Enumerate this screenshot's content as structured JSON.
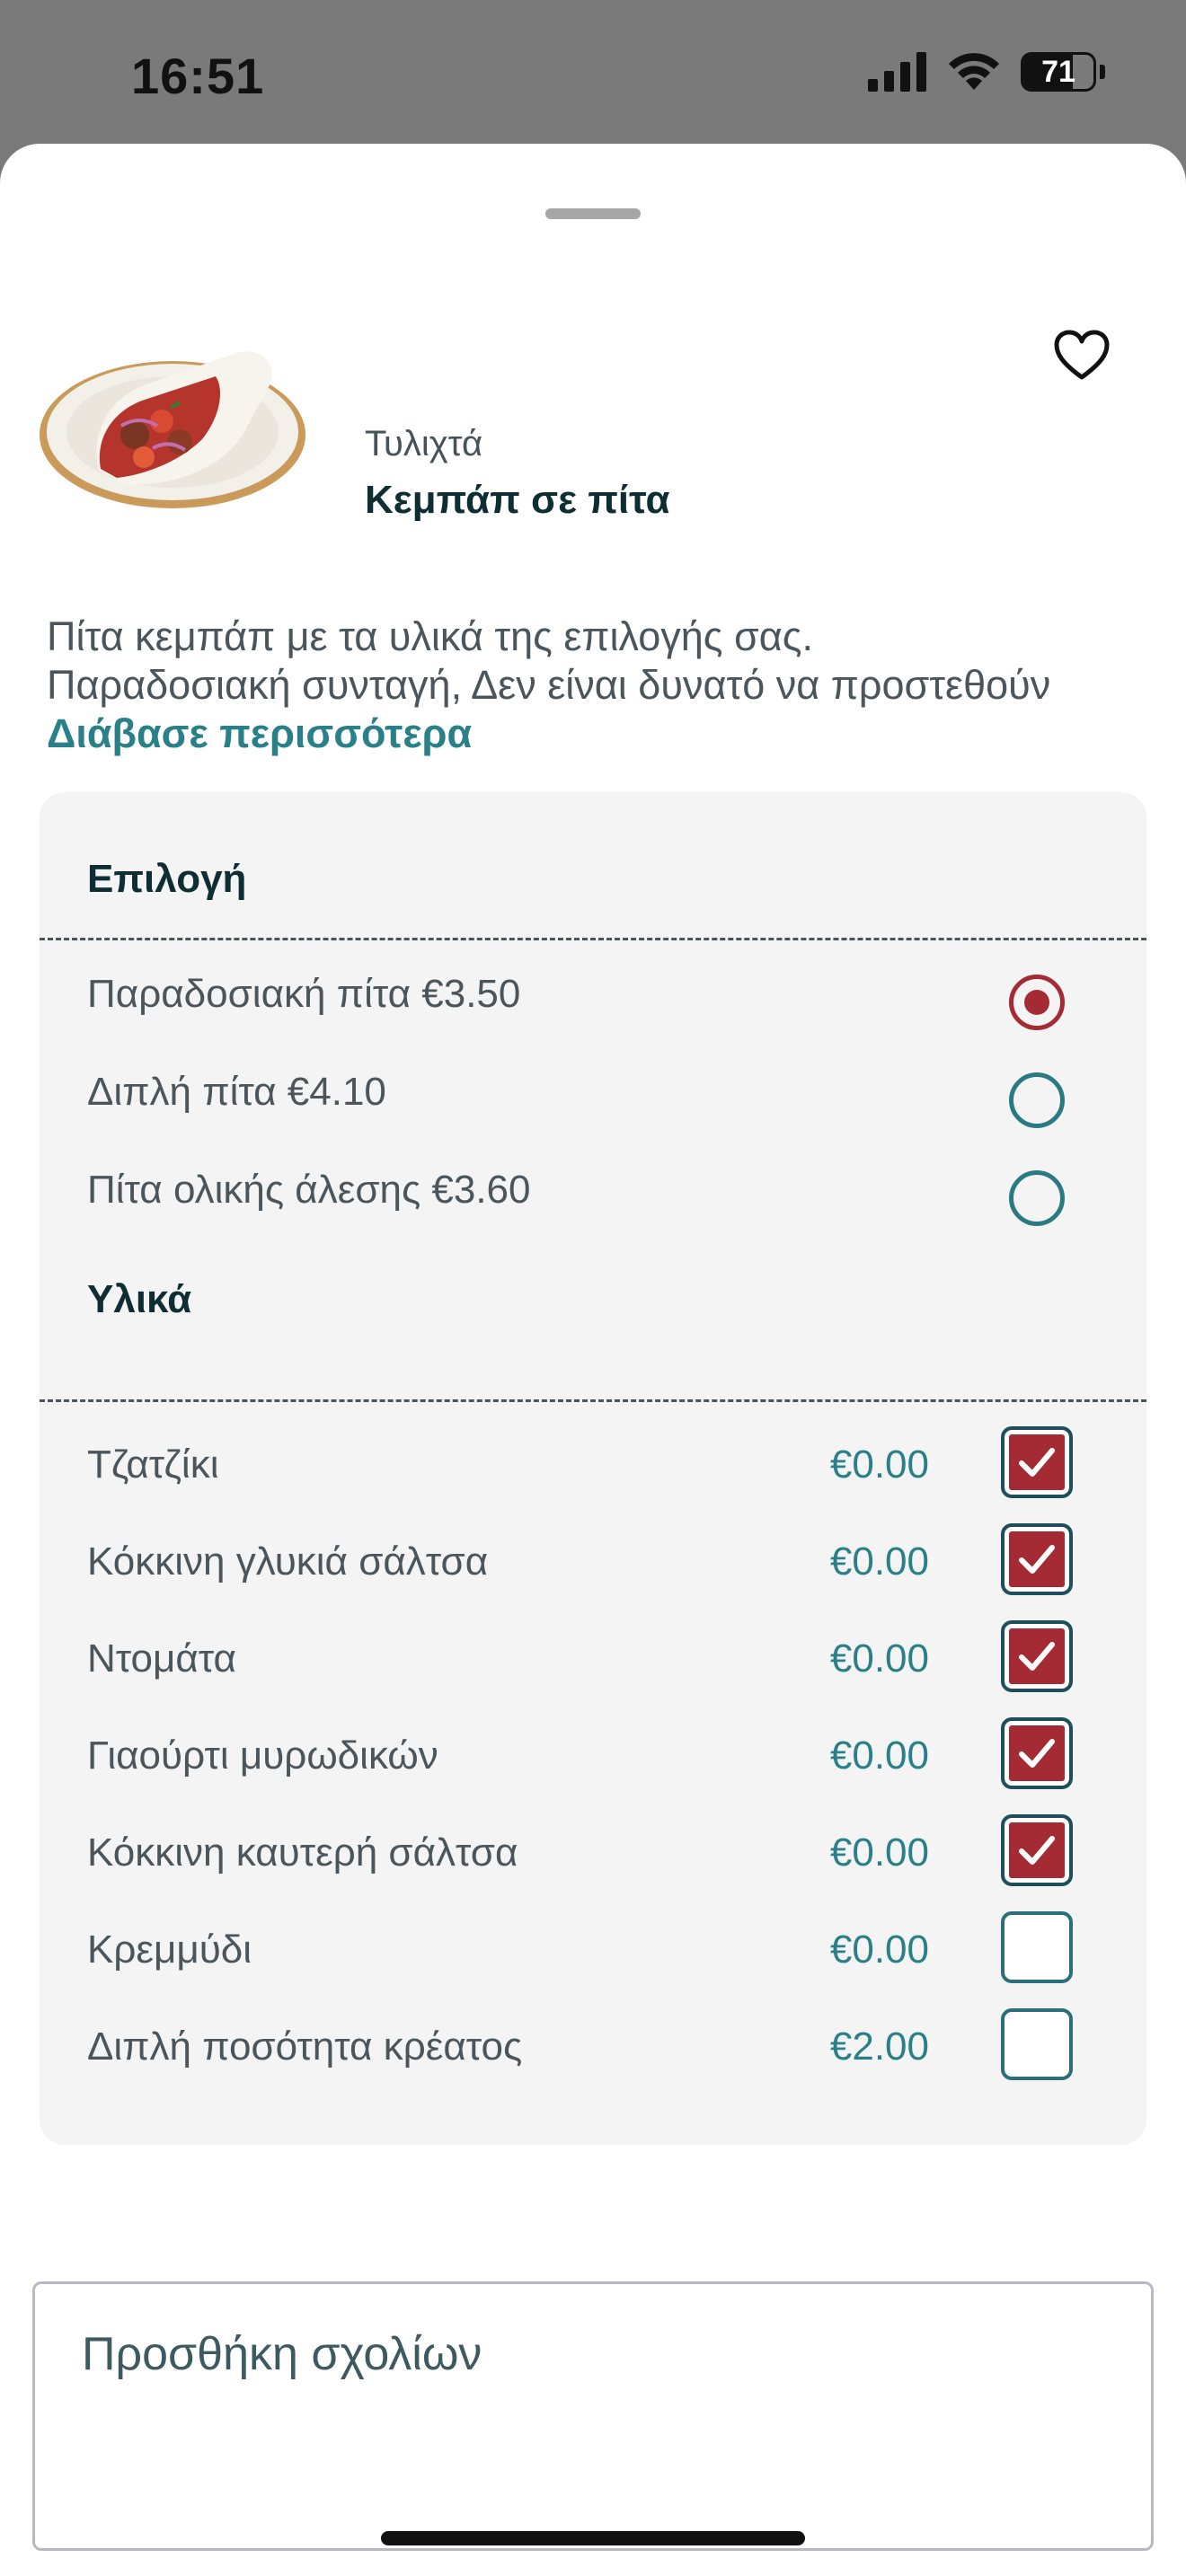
{
  "status_bar": {
    "time": "16:51",
    "battery_percent": 71,
    "battery_text": "71",
    "icons": [
      "signal-icon",
      "wifi-icon",
      "battery-icon"
    ]
  },
  "product": {
    "category": "Τυλιχτά",
    "title": "Κεμπάπ σε πίτα",
    "favorite_icon": "heart-outline-icon",
    "description_lines": [
      "Πίτα κεμπάπ με τα υλικά της επιλογής σας.",
      "Παραδοσιακή συνταγή, Δεν είναι δυνατό να προστεθούν"
    ],
    "read_more": "Διάβασε περισσότερα"
  },
  "choice_section": {
    "title": "Επιλογή",
    "options": [
      {
        "label": "Παραδοσιακή πίτα €3.50",
        "selected": true
      },
      {
        "label": "Διπλή πίτα €4.10",
        "selected": false
      },
      {
        "label": "Πίτα ολικής άλεσης €3.60",
        "selected": false
      }
    ]
  },
  "ingredients_section": {
    "title": "Υλικά",
    "items": [
      {
        "label": "Τζατζίκι",
        "price": "€0.00",
        "checked": true
      },
      {
        "label": "Κόκκινη γλυκιά σάλτσα",
        "price": "€0.00",
        "checked": true
      },
      {
        "label": "Ντομάτα",
        "price": "€0.00",
        "checked": true
      },
      {
        "label": "Γιαούρτι μυρωδικών",
        "price": "€0.00",
        "checked": true
      },
      {
        "label": "Κόκκινη καυτερή σάλτσα",
        "price": "€0.00",
        "checked": true
      },
      {
        "label": "Κρεμμύδι",
        "price": "€0.00",
        "checked": false
      },
      {
        "label": "Διπλή ποσότητα κρέατος",
        "price": "€2.00",
        "checked": false
      }
    ]
  },
  "comments": {
    "placeholder": "Προσθήκη σχολίων"
  },
  "colors": {
    "accent_red": "#a42a33",
    "accent_teal": "#2a8089",
    "title_dark": "#0f2e33"
  }
}
